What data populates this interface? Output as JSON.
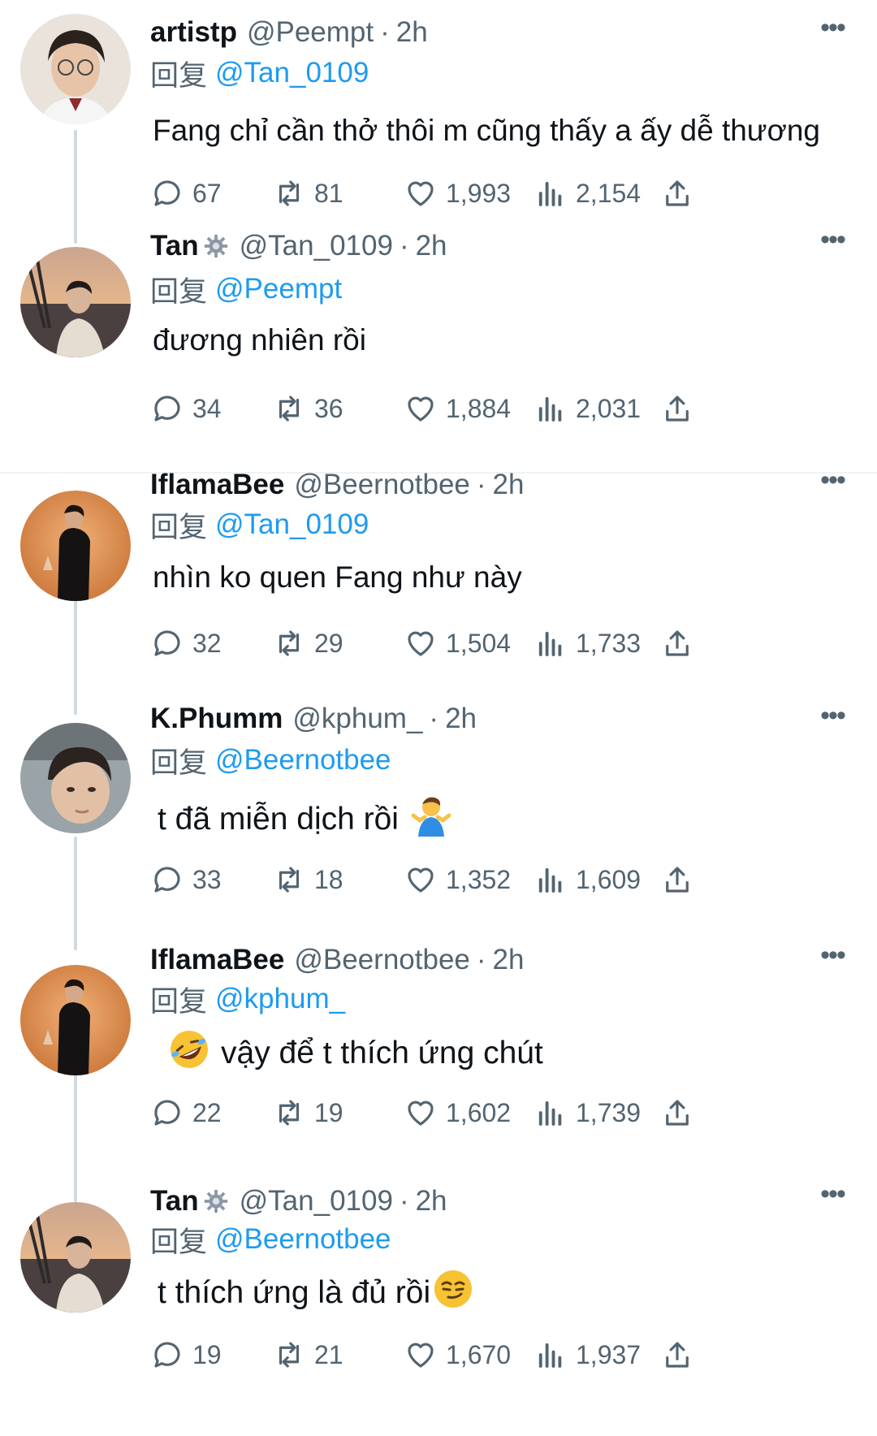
{
  "colors": {
    "text": "#0f1419",
    "secondary": "#536471",
    "accent": "#1d9bf0",
    "line": "#cfd9de"
  },
  "reply_prefix": "回复",
  "tweets": [
    {
      "name": "artistp",
      "badge": false,
      "handle": "@Peempt",
      "dot": "·",
      "time": "2h",
      "reply_to": "@Tan_0109",
      "text": "Fang chỉ cần thở thôi m cũng thấy a ấy dễ thương",
      "emoji": "",
      "replies": "67",
      "retweets": "81",
      "likes": "1,993",
      "views": "2,154"
    },
    {
      "name": "Tan",
      "badge": true,
      "handle": "@Tan_0109",
      "dot": "·",
      "time": "2h",
      "reply_to": "@Peempt",
      "text": "đương nhiên rồi",
      "emoji": "",
      "replies": "34",
      "retweets": "36",
      "likes": "1,884",
      "views": "2,031"
    },
    {
      "name": "IflamaBee",
      "badge": false,
      "handle": "@Beernotbee",
      "dot": "·",
      "time": "2h",
      "reply_to": "@Tan_0109",
      "text": "nhìn ko quen Fang như này",
      "emoji": "",
      "replies": "32",
      "retweets": "29",
      "likes": "1,504",
      "views": "1,733"
    },
    {
      "name": "K.Phumm",
      "badge": false,
      "handle": "@kphum_",
      "dot": "·",
      "time": "2h",
      "reply_to": "@Beernotbee",
      "text": "t đã miễn dịch rồi",
      "emoji": "shrug-emoji",
      "replies": "33",
      "retweets": "18",
      "likes": "1,352",
      "views": "1,609"
    },
    {
      "name": "IflamaBee",
      "badge": false,
      "handle": "@Beernotbee",
      "dot": "·",
      "time": "2h",
      "reply_to": "@kphum_",
      "text": "vậy để t thích ứng chút",
      "emoji": "rofl-emoji",
      "replies": "22",
      "retweets": "19",
      "likes": "1,602",
      "views": "1,739"
    },
    {
      "name": "Tan",
      "badge": true,
      "handle": "@Tan_0109",
      "dot": "·",
      "time": "2h",
      "reply_to": "@Beernotbee",
      "text": "t thích ứng là đủ rồi",
      "emoji": "smirk-emoji",
      "replies": "19",
      "retweets": "21",
      "likes": "1,670",
      "views": "1,937"
    }
  ]
}
